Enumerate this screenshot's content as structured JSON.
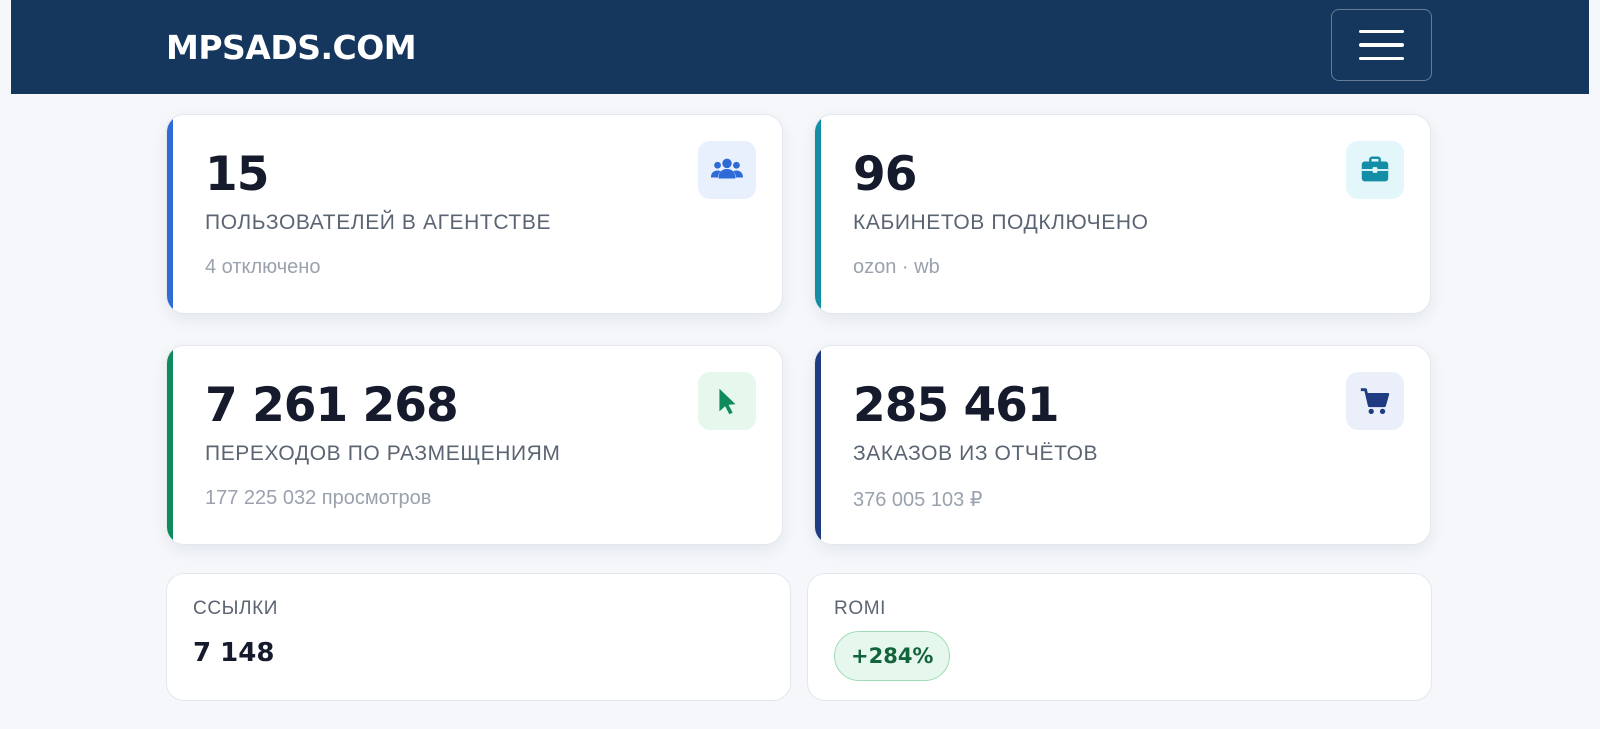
{
  "header": {
    "brand": "MPSADS.COM"
  },
  "stats": [
    {
      "value": "15",
      "label": "ПОЛЬЗОВАТЕЛЕЙ В АГЕНТСТВЕ",
      "sub": "4 отключено",
      "icon": "users-icon",
      "accent": "#2f6bd6"
    },
    {
      "value": "96",
      "label": "КАБИНЕТОВ ПОДКЛЮЧЕНО",
      "sub": "ozon · wb",
      "icon": "briefcase-icon",
      "accent": "#148ea6"
    },
    {
      "value": "7 261 268",
      "label": "ПЕРЕХОДОВ ПО РАЗМЕЩЕНИЯМ",
      "sub": "177 225 032 просмотров",
      "icon": "cursor-icon",
      "accent": "#0f8a5a"
    },
    {
      "value": "285 461",
      "label": "ЗАКАЗОВ ИЗ ОТЧЁТОВ",
      "sub": "376 005 103 ₽",
      "icon": "cart-icon",
      "accent": "#1f3b82"
    }
  ],
  "links": {
    "label": "ССЫЛКИ",
    "value": "7 148"
  },
  "romi": {
    "label": "ROMI",
    "value": "+284%"
  }
}
